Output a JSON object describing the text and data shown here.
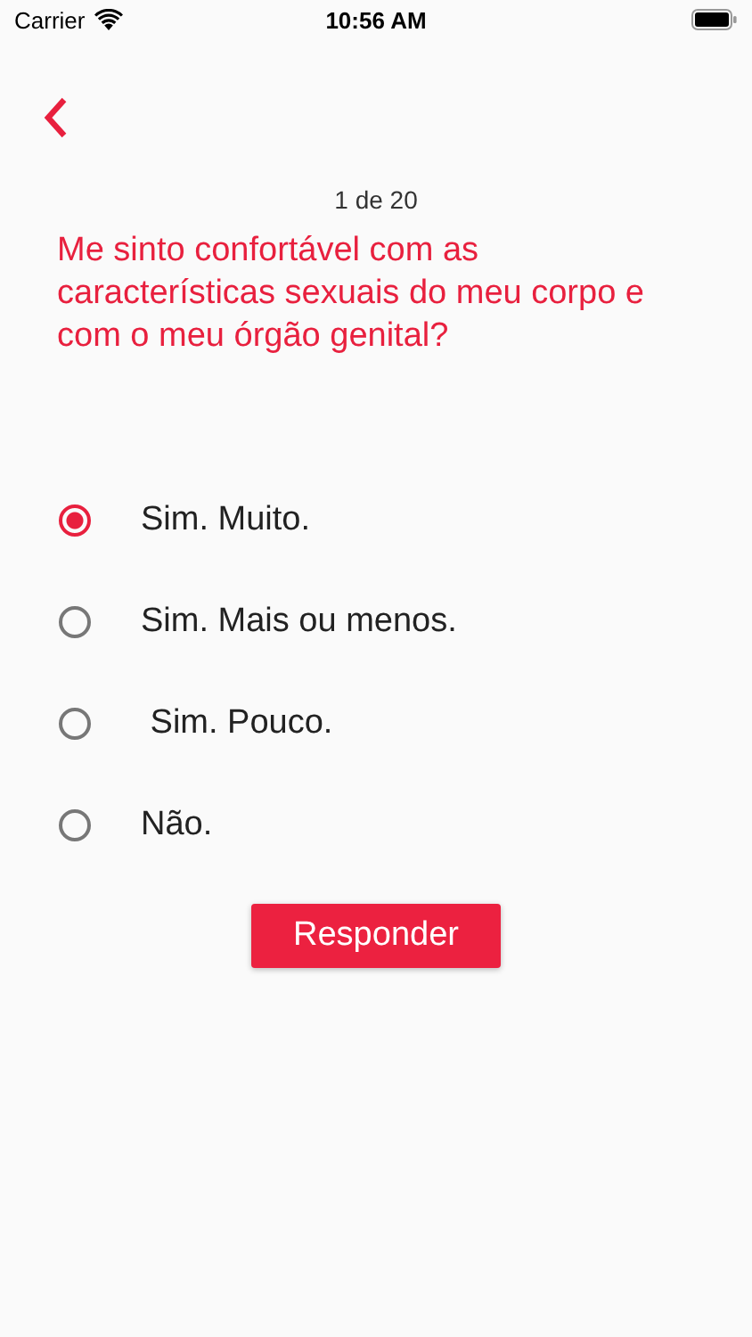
{
  "status_bar": {
    "carrier": "Carrier",
    "time": "10:56 AM"
  },
  "progress": "1 de 20",
  "question": "Me sinto confortável com as características sexuais do meu corpo e com o meu órgão genital?",
  "options": [
    {
      "label": "Sim. Muito.",
      "selected": true
    },
    {
      "label": "Sim. Mais ou menos.",
      "selected": false
    },
    {
      "label": " Sim. Pouco.",
      "selected": false
    },
    {
      "label": "Não.",
      "selected": false
    }
  ],
  "submit_button": "Responder"
}
